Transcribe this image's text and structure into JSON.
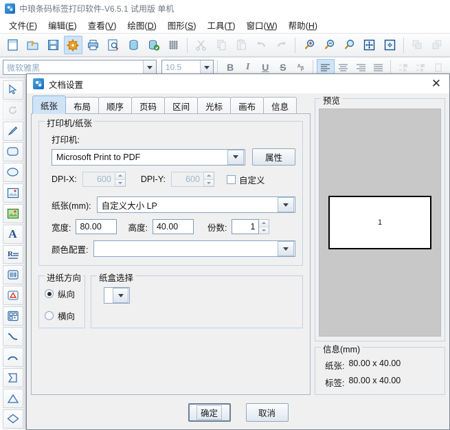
{
  "window": {
    "title": "中琅条码标签打印软件-V6.5.1 试用版 单机",
    "app_icon": "app-logo-icon"
  },
  "menubar": [
    {
      "label": "文件",
      "accel": "F"
    },
    {
      "label": "编辑",
      "accel": "E"
    },
    {
      "label": "查看",
      "accel": "V"
    },
    {
      "label": "绘图",
      "accel": "D"
    },
    {
      "label": "图形",
      "accel": "S"
    },
    {
      "label": "工具",
      "accel": "T"
    },
    {
      "label": "窗口",
      "accel": "W"
    },
    {
      "label": "帮助",
      "accel": "H"
    }
  ],
  "toolbar_main": [
    {
      "icon": "new-document-icon",
      "active": false
    },
    {
      "icon": "open-folder-icon",
      "active": false
    },
    {
      "icon": "save-disk-icon",
      "active": false
    },
    {
      "icon": "document-settings-icon",
      "active": true
    },
    {
      "icon": "print-icon",
      "active": false
    },
    {
      "icon": "print-preview-icon",
      "active": false
    },
    {
      "icon": "database-icon",
      "active": false
    },
    {
      "icon": "database-connect-icon",
      "active": false
    },
    {
      "icon": "grid-icon",
      "active": false
    },
    {
      "sep": true
    },
    {
      "icon": "cut-scissors-icon",
      "active": false,
      "disabled": true
    },
    {
      "icon": "copy-icon",
      "active": false,
      "disabled": true
    },
    {
      "icon": "paste-icon",
      "active": false,
      "disabled": true
    },
    {
      "icon": "undo-arrow-icon",
      "active": false,
      "disabled": true
    },
    {
      "icon": "redo-arrow-icon",
      "active": false,
      "disabled": true
    },
    {
      "sep": true
    },
    {
      "icon": "zoom-in-icon",
      "active": false
    },
    {
      "icon": "zoom-out-icon",
      "active": false
    },
    {
      "icon": "zoom-actual-icon",
      "active": false
    },
    {
      "icon": "fit-page-icon",
      "active": false
    },
    {
      "icon": "fit-width-icon",
      "active": false
    },
    {
      "sep": true
    },
    {
      "icon": "bring-front-icon",
      "active": false,
      "disabled": true
    },
    {
      "icon": "send-back-icon",
      "active": false,
      "disabled": true
    }
  ],
  "format_bar": {
    "font_name": "微软雅黑",
    "font_size": "10.5",
    "buttons": [
      {
        "icon": "bold-icon",
        "label": "B",
        "active": false
      },
      {
        "icon": "italic-icon",
        "label": "I",
        "active": false
      },
      {
        "icon": "underline-icon",
        "label": "U",
        "active": false
      },
      {
        "icon": "strikethrough-icon",
        "label": "S",
        "active": false
      },
      {
        "icon": "text-effect-icon",
        "label": "ᴬᵦ",
        "active": false
      }
    ],
    "align_buttons": [
      {
        "icon": "align-left-icon",
        "active": true
      },
      {
        "icon": "align-center-icon",
        "active": false
      },
      {
        "icon": "align-right-icon",
        "active": false
      },
      {
        "icon": "align-justify-icon",
        "active": false
      }
    ],
    "extra_buttons": [
      {
        "icon": "indent-decrease-icon"
      },
      {
        "icon": "indent-increase-icon"
      },
      {
        "icon": "list-icon"
      }
    ]
  },
  "left_toolbar": [
    {
      "icon": "pointer-select-icon",
      "disabled": false
    },
    {
      "icon": "rotate-icon",
      "disabled": true
    },
    {
      "icon": "line-pen-icon",
      "disabled": false
    },
    {
      "icon": "rounded-rectangle-icon",
      "disabled": false
    },
    {
      "icon": "ellipse-icon",
      "disabled": false
    },
    {
      "icon": "image-icon",
      "disabled": false
    },
    {
      "icon": "picture-color-icon",
      "disabled": false
    },
    {
      "icon": "text-a-icon",
      "disabled": false
    },
    {
      "icon": "rich-text-icon",
      "disabled": false
    },
    {
      "icon": "barcode-icon",
      "disabled": false
    },
    {
      "icon": "warning-shape-icon",
      "disabled": false
    },
    {
      "icon": "qrcode-icon",
      "disabled": false
    },
    {
      "icon": "curve-icon",
      "disabled": false
    },
    {
      "icon": "arc-icon",
      "disabled": false
    },
    {
      "icon": "polygon-icon",
      "disabled": false
    },
    {
      "icon": "triangle-icon",
      "disabled": false
    },
    {
      "icon": "diamond-icon",
      "disabled": false
    }
  ],
  "dialog": {
    "title": "文档设置",
    "close_label": "✕",
    "tabs": [
      {
        "label": "纸张",
        "active": true
      },
      {
        "label": "布局",
        "active": false
      },
      {
        "label": "顺序",
        "active": false
      },
      {
        "label": "页码",
        "active": false
      },
      {
        "label": "区间",
        "active": false
      },
      {
        "label": "光标",
        "active": false
      },
      {
        "label": "画布",
        "active": false
      },
      {
        "label": "信息",
        "active": false
      }
    ],
    "printer_group": {
      "legend": "打印机/纸张",
      "printer_label": "打印机:",
      "printer_value": "Microsoft Print to PDF",
      "properties_button": "属性",
      "dpi_x_label": "DPI-X:",
      "dpi_x_value": "600",
      "dpi_y_label": "DPI-Y:",
      "dpi_y_value": "600",
      "custom_checkbox_label": "自定义",
      "custom_checked": false,
      "paper_label": "纸张(mm):",
      "paper_value": "自定义大小 LP",
      "width_label": "宽度:",
      "width_value": "80.00",
      "height_label": "高度:",
      "height_value": "40.00",
      "copies_label": "份数:",
      "copies_value": "1",
      "color_profile_label": "颜色配置:",
      "color_profile_value": ""
    },
    "feed_group": {
      "legend": "进纸方向",
      "options": [
        {
          "label": "纵向",
          "selected": true
        },
        {
          "label": "横向",
          "selected": false
        }
      ]
    },
    "tray_group": {
      "legend": "纸盒选择",
      "value": ""
    },
    "preview_group": {
      "legend": "预览",
      "page_number": "1"
    },
    "info_group": {
      "legend": "信息(mm)",
      "rows": [
        {
          "key": "纸张:",
          "value": "80.00 x 40.00"
        },
        {
          "key": "标签:",
          "value": "80.00 x 40.00"
        }
      ]
    },
    "footer": {
      "ok_label": "确定",
      "cancel_label": "取消"
    }
  },
  "colors": {
    "accent": "#cfe3f7",
    "dialog_bg": "#f0f0f0",
    "border": "#a9b4c2",
    "preview_bg": "#c8c8c8"
  }
}
